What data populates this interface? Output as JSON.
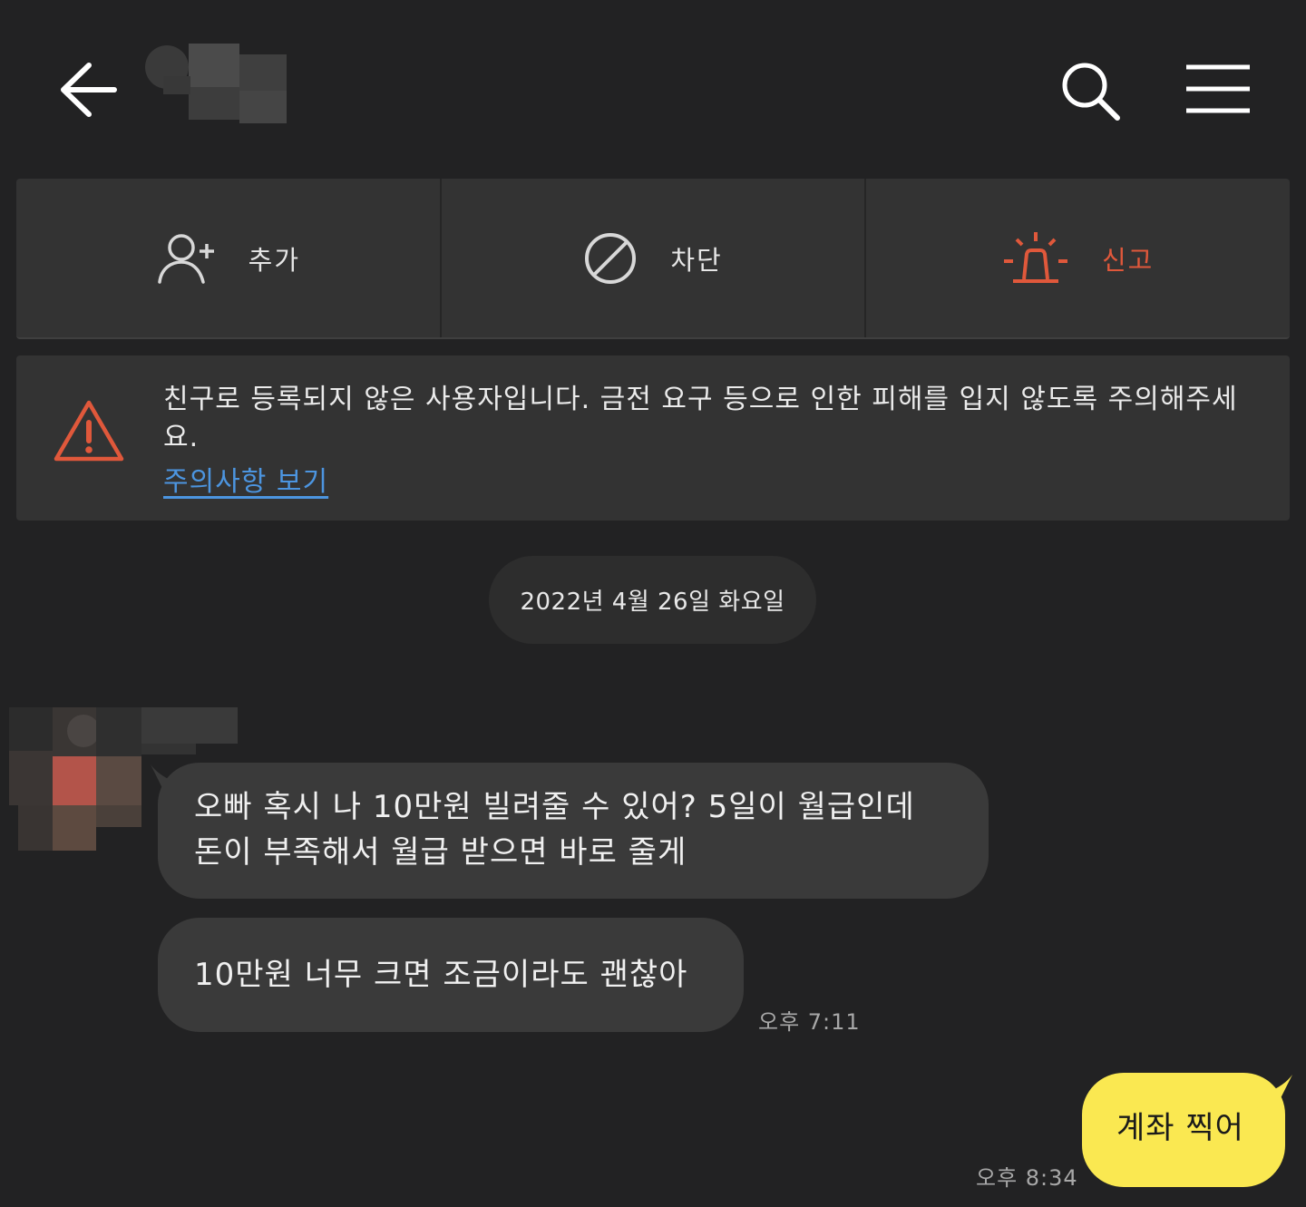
{
  "header": {
    "back_icon": "arrow-left-icon",
    "search_icon": "search-icon",
    "menu_icon": "hamburger-menu-icon"
  },
  "actions": {
    "add": {
      "label": "추가",
      "icon": "add-user-icon"
    },
    "block": {
      "label": "차단",
      "icon": "block-icon"
    },
    "report": {
      "label": "신고",
      "icon": "siren-icon",
      "color": "#e0583b"
    }
  },
  "notice": {
    "text": "친구로 등록되지 않은 사용자입니다. 금전 요구 등으로 인한 피해를 입지 않도록 주의해주세요.",
    "link": "주의사항 보기",
    "icon": "warning-triangle-icon",
    "link_color": "#4c95e0"
  },
  "date_divider": "2022년 4월 26일 화요일",
  "messages": [
    {
      "from": "other",
      "text_line1": "오빠 혹시 나 10만원 빌려줄 수 있어? 5일이 월급인데",
      "text_line2": "돈이 부족해서 월급 받으면 바로 줄게"
    },
    {
      "from": "other",
      "text": "10만원 너무 크면 조금이라도 괜찮아",
      "time": "오후 7:11"
    },
    {
      "from": "me",
      "text": "계좌 찍어",
      "time": "오후 8:34"
    }
  ],
  "colors": {
    "background": "#222223",
    "my_bubble": "#fae851",
    "other_bubble": "#3a3a3a"
  }
}
